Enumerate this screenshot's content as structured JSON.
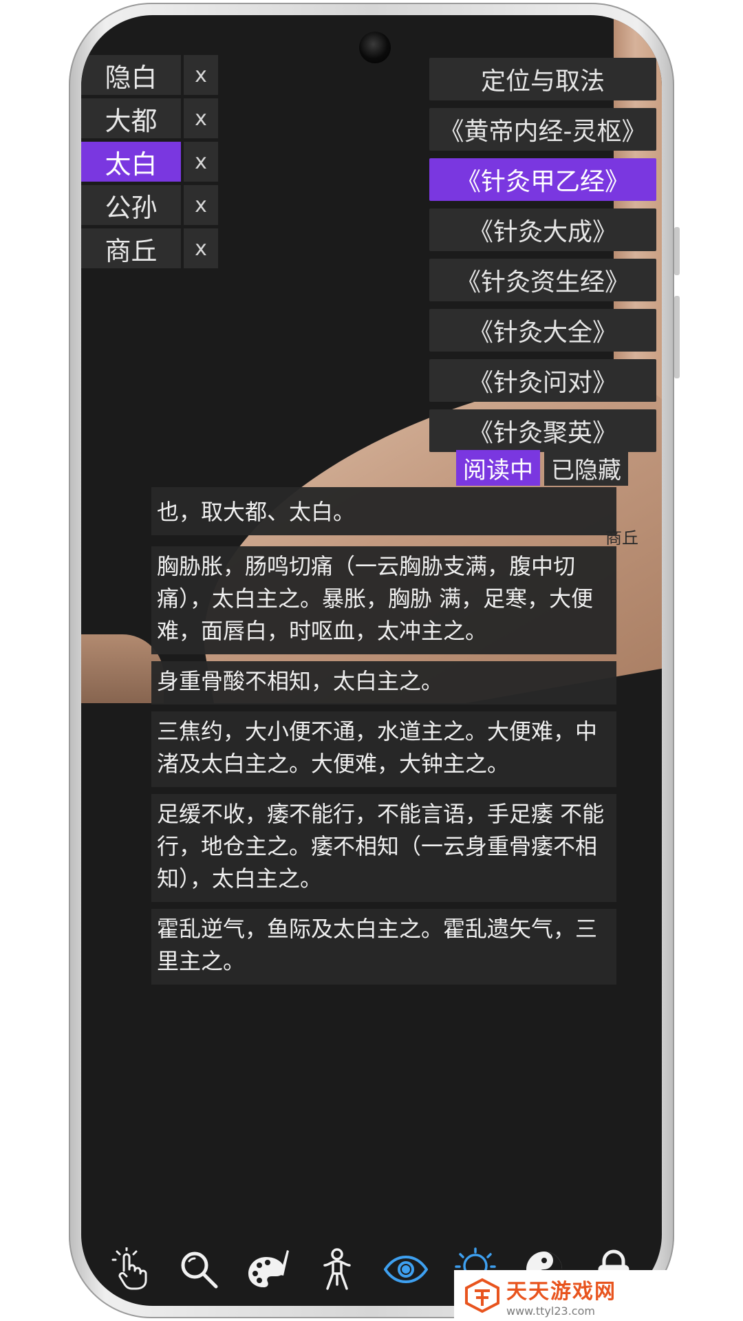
{
  "points": [
    {
      "name": "隐白",
      "close": "x",
      "active": false
    },
    {
      "name": "大都",
      "close": "x",
      "active": false
    },
    {
      "name": "太白",
      "close": "x",
      "active": true
    },
    {
      "name": "公孙",
      "close": "x",
      "active": false
    },
    {
      "name": "商丘",
      "close": "x",
      "active": false
    }
  ],
  "sources": [
    {
      "label": "定位与取法",
      "active": false
    },
    {
      "label": "《黄帝内经-灵枢》",
      "active": false
    },
    {
      "label": "《针灸甲乙经》",
      "active": true
    },
    {
      "label": "《针灸大成》",
      "active": false
    },
    {
      "label": "《针灸资生经》",
      "active": false
    },
    {
      "label": "《针灸大全》",
      "active": false
    },
    {
      "label": "《针灸问对》",
      "active": false
    },
    {
      "label": "《针灸聚英》",
      "active": false
    }
  ],
  "model_label": "商丘",
  "toggles": {
    "reading": "阅读中",
    "hidden": "已隐藏"
  },
  "passages": [
    "也，取大都、太白。",
    " 胸胁胀，肠鸣切痛（一云胸胁支满，腹中切痛），太白主之。暴胀，胸胁 满，足寒，大便难，面唇白，时呕血，太冲主之。",
    " 身重骨酸不相知，太白主之。",
    " 三焦约，大小便不通，水道主之。大便难，中渚及太白主之。大便难，大钟主之。",
    " 足缓不收，痿不能行，不能言语，手足痿 不能行，地仓主之。痿不相知（一云身重骨痿不相知），太白主之。",
    " 霍乱逆气，鱼际及太白主之。霍乱遗矢气，三里主之。"
  ],
  "toolbar": [
    {
      "icon": "tap-hand-icon"
    },
    {
      "icon": "search-icon"
    },
    {
      "icon": "palette-icon"
    },
    {
      "icon": "person-icon"
    },
    {
      "icon": "eye-icon",
      "active": true
    },
    {
      "icon": "lightbulb-icon",
      "active": true
    },
    {
      "icon": "yin-yang-icon"
    },
    {
      "icon": "lock-icon"
    }
  ],
  "colors": {
    "accent": "#7a37e0",
    "toolbar_active": "#3ea0f0",
    "panel": "#2e2e2e",
    "background": "#1b1b1b"
  },
  "watermark": {
    "title": "天天游戏网",
    "url": "www.ttyl23.com"
  }
}
